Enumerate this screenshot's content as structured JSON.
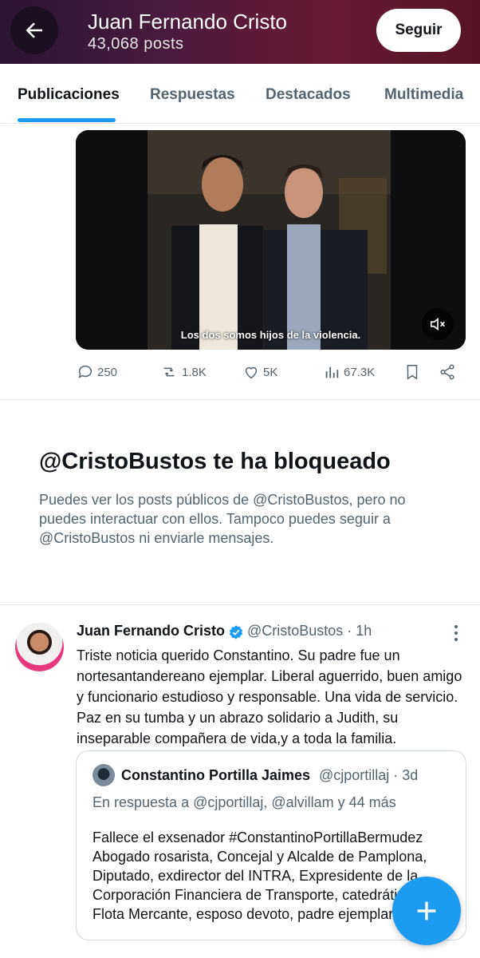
{
  "header": {
    "name": "Juan Fernando Cristo",
    "posts": "43,068 posts",
    "follow_label": "Seguir"
  },
  "tabs": [
    {
      "label": "Publicaciones",
      "active": true
    },
    {
      "label": "Respuestas",
      "active": false
    },
    {
      "label": "Destacados",
      "active": false
    },
    {
      "label": "Multimedia",
      "active": false
    }
  ],
  "media_post": {
    "caption": "Los dos somos hijos de la violencia.",
    "stats": {
      "replies": "250",
      "reposts": "1.8K",
      "likes": "5K",
      "views": "67.3K"
    }
  },
  "blocked": {
    "title": "@CristoBustos te ha bloqueado",
    "text": "Puedes ver los posts públicos de @CristoBustos, pero no puedes interactuar con ellos. Tampoco puedes seguir a @CristoBustos ni enviarle mensajes."
  },
  "tweet": {
    "name": "Juan Fernando Cristo",
    "handle_time": "@CristoBustos · 1h",
    "text": "Triste noticia querido Constantino. Su padre fue un nortesantandereano ejemplar. Liberal aguerrido, buen amigo y funcionario estudioso y responsable. Una vida de servicio. Paz en su tumba y un abrazo solidario a Judith, su inseparable compañera de vida,y a toda la familia.",
    "quote": {
      "name": "Constantino Portilla Jaimes",
      "handle_time": "@cjportillaj · 3d",
      "reply_to": "En respuesta a @cjportillaj, @alvillam y 44 más",
      "text": "Fallece el exsenador #ConstantinoPortillaBermudez Abogado rosarista, Concejal y Alcalde de Pamplona, Diputado, exdirector del INTRA, Expresidente de la Corporación Financiera de Transporte, catedrático, VP Flota Mercante, esposo devoto, padre ejemplar"
    }
  },
  "colors": {
    "accent": "#1d9bf0",
    "secondary_text": "#536471",
    "primary_text": "#0f1419"
  },
  "icons": [
    "back-arrow-icon",
    "mute-icon",
    "reply-icon",
    "repost-icon",
    "like-icon",
    "views-icon",
    "bookmark-icon",
    "share-icon",
    "verified-icon",
    "more-icon",
    "compose-plus-icon"
  ]
}
